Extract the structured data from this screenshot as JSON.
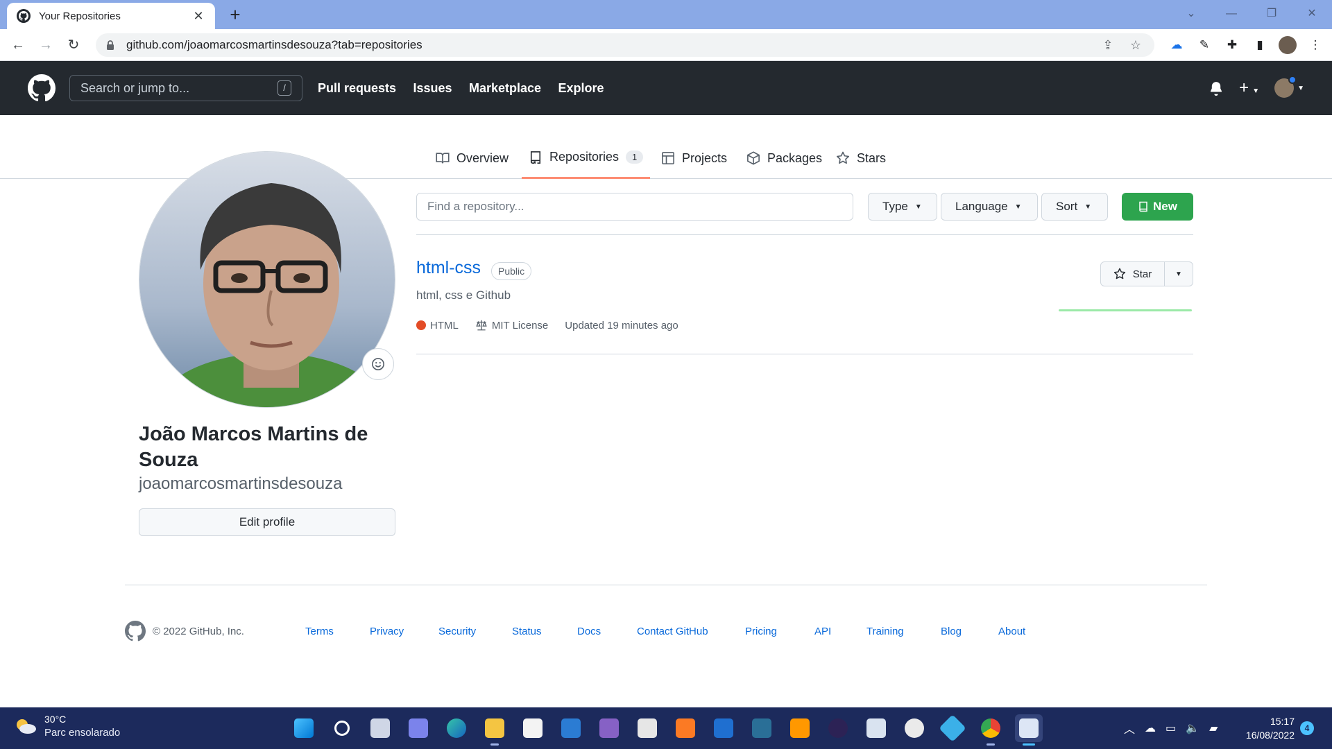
{
  "browser": {
    "tab_title": "Your Repositories",
    "tab_close": "✕",
    "new_tab": "+",
    "url": "github.com/joaomarcosmartinsdesouza?tab=repositories",
    "window_controls": [
      "⌄",
      "—",
      "❐",
      "✕"
    ]
  },
  "header": {
    "search_placeholder": "Search or jump to...",
    "search_shortcut": "/",
    "nav": [
      "Pull requests",
      "Issues",
      "Marketplace",
      "Explore"
    ],
    "plus": "+"
  },
  "profile_tabs": {
    "overview": "Overview",
    "repositories": "Repositories",
    "repositories_count": "1",
    "projects": "Projects",
    "packages": "Packages",
    "stars": "Stars"
  },
  "profile": {
    "full_name": "João Marcos Martins de Souza",
    "username": "joaomarcosmartinsdesouza",
    "edit_label": "Edit profile"
  },
  "filters": {
    "find_placeholder": "Find a repository...",
    "type_label": "Type",
    "language_label": "Language",
    "sort_label": "Sort",
    "new_label": "New"
  },
  "repo": {
    "name": "html-css",
    "visibility": "Public",
    "description": "html, css e Github",
    "language": "HTML",
    "language_color": "#e34c26",
    "license": "MIT License",
    "updated": "Updated 19 minutes ago",
    "star_label": "Star"
  },
  "footer": {
    "copyright": "© 2022 GitHub, Inc.",
    "links": [
      "Terms",
      "Privacy",
      "Security",
      "Status",
      "Docs",
      "Contact GitHub",
      "Pricing",
      "API",
      "Training",
      "Blog",
      "About"
    ]
  },
  "taskbar": {
    "temperature": "30°C",
    "condition": "Parc ensolarado",
    "time": "15:17",
    "date": "16/08/2022",
    "notifications": "4"
  },
  "colors": {
    "accent_blue": "#0969da",
    "green": "#2da44e",
    "header_bg": "#24292f",
    "tab_underline": "#fd8c73"
  }
}
